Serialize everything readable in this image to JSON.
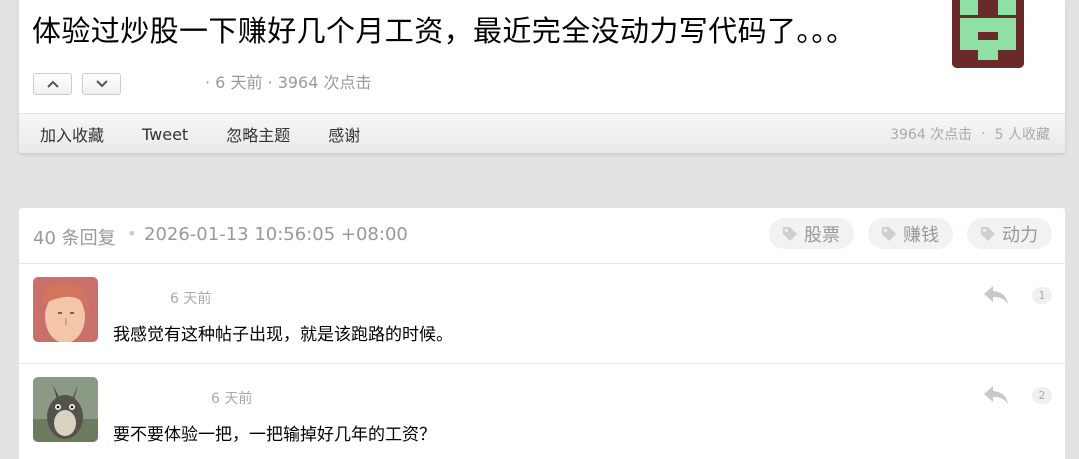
{
  "topic": {
    "title": "体验过炒股一下赚好几个月工资，最近完全没动力写代码了。。。",
    "meta": "· 6 天前 · 3964 次点击",
    "vote_up_icon": "chevron-up-icon",
    "vote_down_icon": "chevron-down-icon",
    "avatar_colors": {
      "background": "#6b2a2a",
      "foreground": "#8ee0a4"
    }
  },
  "toolbar": {
    "favorite": "加入收藏",
    "tweet": "Tweet",
    "ignore": "忽略主题",
    "thanks": "感谢",
    "clicks": "3964 次点击",
    "separator": "·",
    "favorites": "5 人收藏"
  },
  "replies_header": {
    "count": "40 条回复",
    "dot": "•",
    "date": "2026-01-13 10:56:05 +08:00",
    "tags": [
      "股票",
      "赚钱",
      "动力"
    ],
    "tag_icon": "tag-icon"
  },
  "replies": [
    {
      "time": "6 天前",
      "content": "我感觉有这种帖子出现，就是该跑路的时候。",
      "floor": "1",
      "reply_icon": "reply-arrow-icon"
    },
    {
      "time": "6 天前",
      "content": "要不要体验一把，一把输掉好几年的工资？",
      "floor": "2",
      "reply_icon": "reply-arrow-icon"
    }
  ],
  "colors": {
    "page_bg": "#e2e2e2",
    "muted_text": "#999999",
    "tag_bg": "#f2f2f2"
  }
}
